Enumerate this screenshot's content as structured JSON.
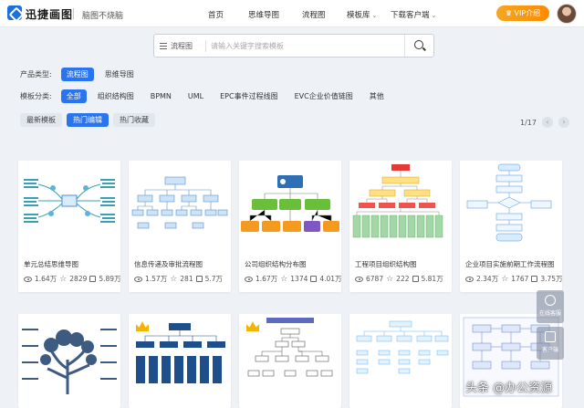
{
  "header": {
    "brand": "迅捷画图",
    "slogan": "脑图不烧脑",
    "nav": [
      {
        "label": "首页",
        "dropdown": false
      },
      {
        "label": "思维导图",
        "dropdown": false
      },
      {
        "label": "流程图",
        "dropdown": false
      },
      {
        "label": "模板库",
        "dropdown": true
      },
      {
        "label": "下载客户端",
        "dropdown": true
      }
    ],
    "vip_label": "VIP介绍"
  },
  "search": {
    "type_label": "流程图",
    "placeholder": "请输入关键字搜索模板"
  },
  "filters": {
    "product_label": "产品类型:",
    "product_options": [
      "流程图",
      "思维导图"
    ],
    "product_selected": 0,
    "category_label": "模板分类:",
    "category_options": [
      "全部",
      "组织结构图",
      "BPMN",
      "UML",
      "EPC事件过程线图",
      "EVC企业价值链图",
      "其他"
    ],
    "category_selected": 0,
    "sort_options": [
      "最新模板",
      "热门编辑",
      "热门收藏"
    ],
    "sort_selected": 1
  },
  "pager": {
    "label": "1/17",
    "prev": "‹",
    "next": "›"
  },
  "cards": [
    {
      "title": "单元总结思维导图",
      "views": "1.64万",
      "stars": "2829",
      "uses": "5.89万"
    },
    {
      "title": "信息传递及审批流程图",
      "views": "1.57万",
      "stars": "281",
      "uses": "5.7万"
    },
    {
      "title": "公司组织结构分布图",
      "views": "1.67万",
      "stars": "1374",
      "uses": "4.01万"
    },
    {
      "title": "工程项目组织结构图",
      "views": "6787",
      "stars": "222",
      "uses": "5.81万"
    },
    {
      "title": "企业项目实施前期工作流程图",
      "views": "2.34万",
      "stars": "1767",
      "uses": "3.75万"
    }
  ],
  "float": {
    "service_label": "在线客服",
    "client_label": "客户端"
  },
  "watermark": "头条 @办公资源",
  "colors": {
    "accent": "#2b74f0",
    "vip": "#f5a623"
  }
}
